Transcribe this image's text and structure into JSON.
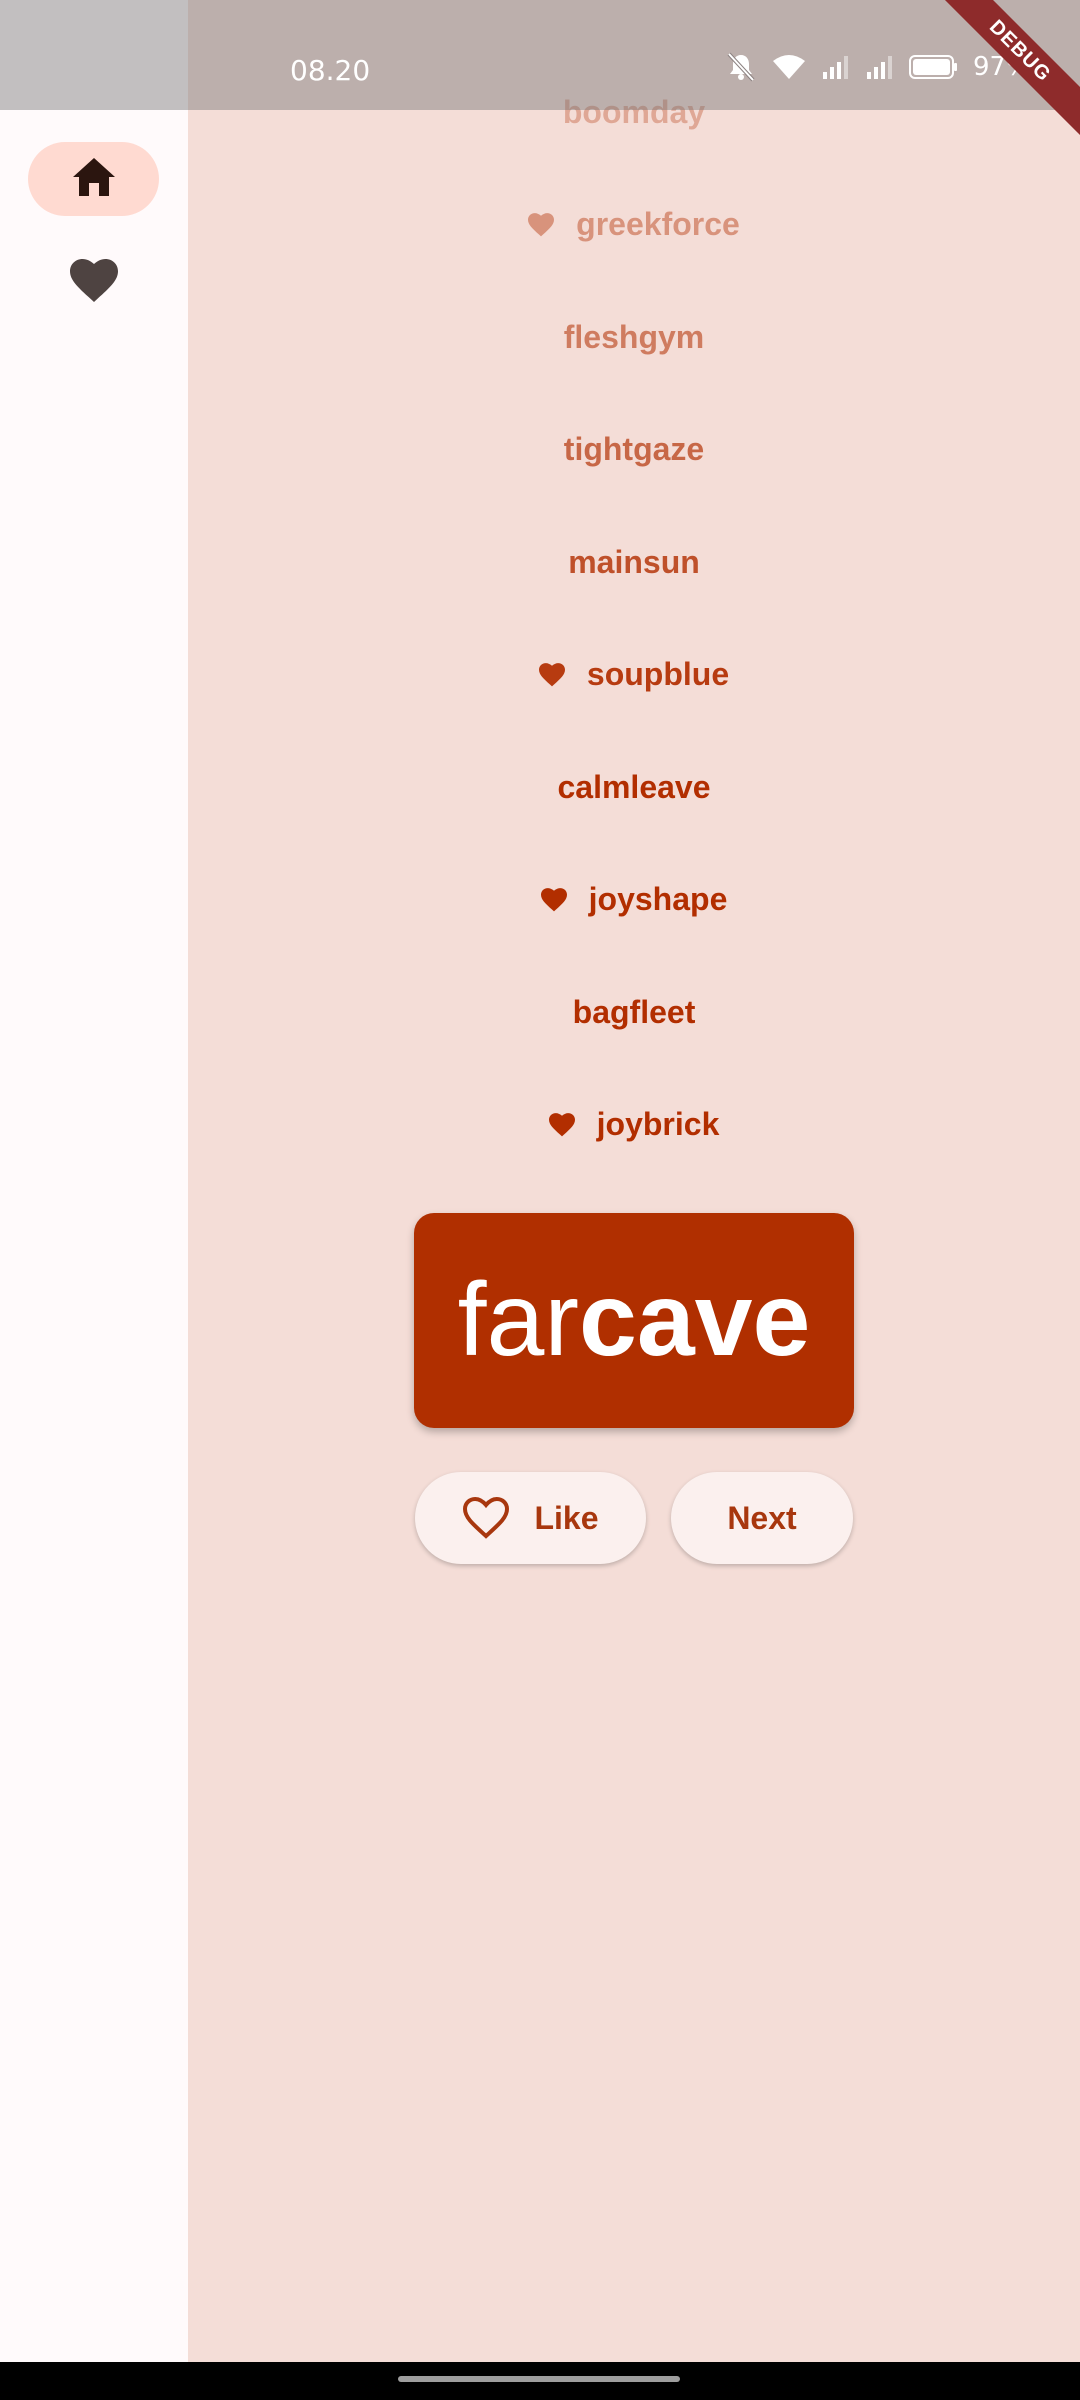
{
  "status_bar": {
    "time": "08.20",
    "battery": "97%",
    "icons": [
      "mute-icon",
      "wifi-icon",
      "signal-icon",
      "signal-icon",
      "battery-icon"
    ]
  },
  "debug_banner": "DEBUG",
  "nav_rail": {
    "items": [
      {
        "icon": "home-icon",
        "selected": true
      },
      {
        "icon": "heart-icon",
        "selected": false
      }
    ]
  },
  "history": [
    {
      "text": "boomday",
      "favorite": false
    },
    {
      "text": "greekforce",
      "favorite": true
    },
    {
      "text": "fleshgym",
      "favorite": false
    },
    {
      "text": "tightgaze",
      "favorite": false
    },
    {
      "text": "mainsun",
      "favorite": false
    },
    {
      "text": "soupblue",
      "favorite": true
    },
    {
      "text": "calmleave",
      "favorite": false
    },
    {
      "text": "joyshape",
      "favorite": true
    },
    {
      "text": "bagfleet",
      "favorite": false
    },
    {
      "text": "joybrick",
      "favorite": true
    }
  ],
  "current_pair": {
    "first": "far",
    "second": "cave"
  },
  "buttons": {
    "like_label": "Like",
    "next_label": "Next"
  },
  "colors": {
    "primary": "#b02f00",
    "background": "#f4ddd7",
    "rail_background": "#fffafb",
    "selected_indicator": "#ffdad1"
  }
}
